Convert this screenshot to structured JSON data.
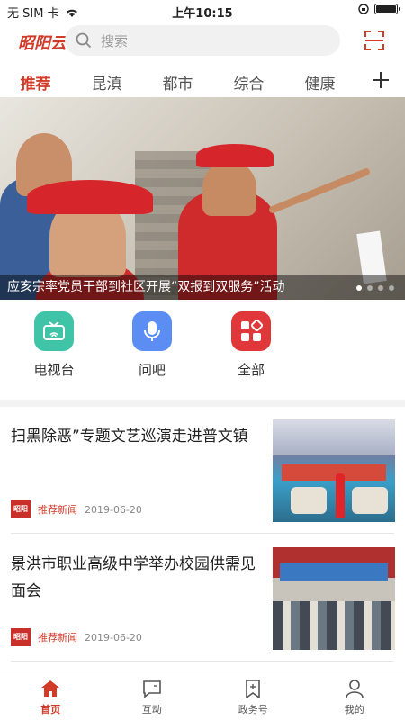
{
  "status": {
    "carrier": "无 SIM 卡",
    "time": "上午10:15"
  },
  "header": {
    "logo": "昭阳云",
    "search_placeholder": "搜索"
  },
  "tabs": [
    {
      "label": "推荐",
      "active": true
    },
    {
      "label": "昆滇"
    },
    {
      "label": "都市"
    },
    {
      "label": "综合"
    },
    {
      "label": "健康"
    }
  ],
  "banner": {
    "caption": "应亥宗率党员干部到社区开展“双报到双服务”活动",
    "slide_count": 4,
    "active_slide": 1
  },
  "quick": [
    {
      "label": "电视台",
      "icon": "tv-icon",
      "color": "#3fc4a8"
    },
    {
      "label": "问吧",
      "icon": "microphone-icon",
      "color": "#5b8df2"
    },
    {
      "label": "全部",
      "icon": "grid-icon",
      "color": "#e0373a"
    }
  ],
  "news": [
    {
      "title": "扫黑除恶”专题文艺巡演走进普文镇",
      "logo": "昭阳云",
      "source": "推荐新闻",
      "date": "2019-06-20"
    },
    {
      "title": "景洪市职业高级中学举办校园供需见面会",
      "logo": "昭阳云",
      "source": "推荐新闻",
      "date": "2019-06-20"
    }
  ],
  "tabbar": [
    {
      "label": "首页",
      "icon": "home-icon",
      "active": true
    },
    {
      "label": "互动",
      "icon": "chat-icon"
    },
    {
      "label": "政务号",
      "icon": "bookmark-icon"
    },
    {
      "label": "我的",
      "icon": "user-icon"
    }
  ],
  "colors": {
    "accent": "#d13b2a"
  }
}
